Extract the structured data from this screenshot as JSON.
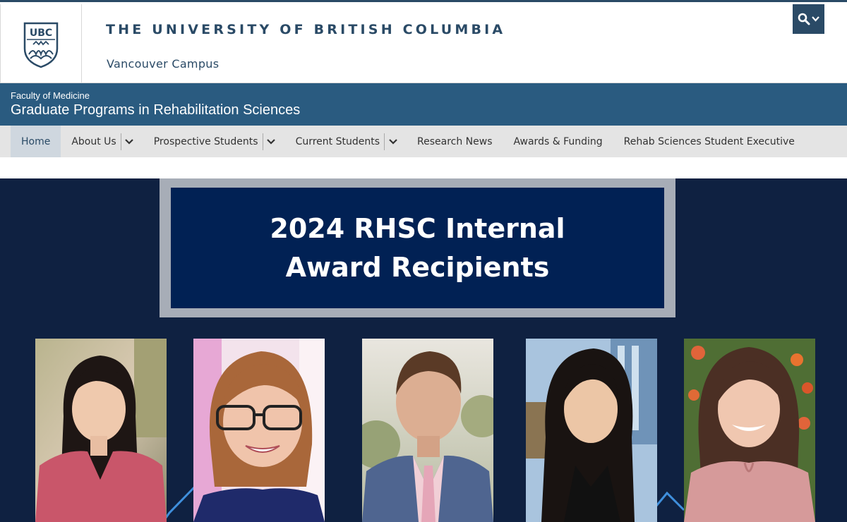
{
  "ubc": {
    "wordmark": "THE UNIVERSITY OF BRITISH COLUMBIA",
    "campus": "Vancouver Campus",
    "crest_text": "UBC",
    "search_icon": "search-icon",
    "brand_color": "#2a4a66"
  },
  "unit": {
    "faculty": "Faculty of Medicine",
    "program": "Graduate Programs in Rehabilitation Sciences",
    "banner_color": "#2a5b80"
  },
  "nav": {
    "items": [
      {
        "label": "Home",
        "active": true
      },
      {
        "label": "About Us",
        "dropdown": true
      },
      {
        "label": "Prospective Students",
        "dropdown": true
      },
      {
        "label": "Current Students",
        "dropdown": true
      },
      {
        "label": "Research News"
      },
      {
        "label": "Awards & Funding"
      },
      {
        "label": "Rehab Sciences Student Executive"
      }
    ]
  },
  "hero": {
    "title_line1": "2024 RHSC Internal",
    "title_line2": "Award Recipients",
    "background_color": "#0f2141",
    "title_box_color": "#012154",
    "frame_color": "#a7adb7",
    "accent_color": "#3f8fdc",
    "photos": [
      {
        "name": "recipient-photo-1",
        "icon": "portrait-image"
      },
      {
        "name": "recipient-photo-2",
        "icon": "portrait-image"
      },
      {
        "name": "recipient-photo-3",
        "icon": "portrait-image"
      },
      {
        "name": "recipient-photo-4",
        "icon": "portrait-image"
      },
      {
        "name": "recipient-photo-5",
        "icon": "portrait-image"
      }
    ]
  }
}
